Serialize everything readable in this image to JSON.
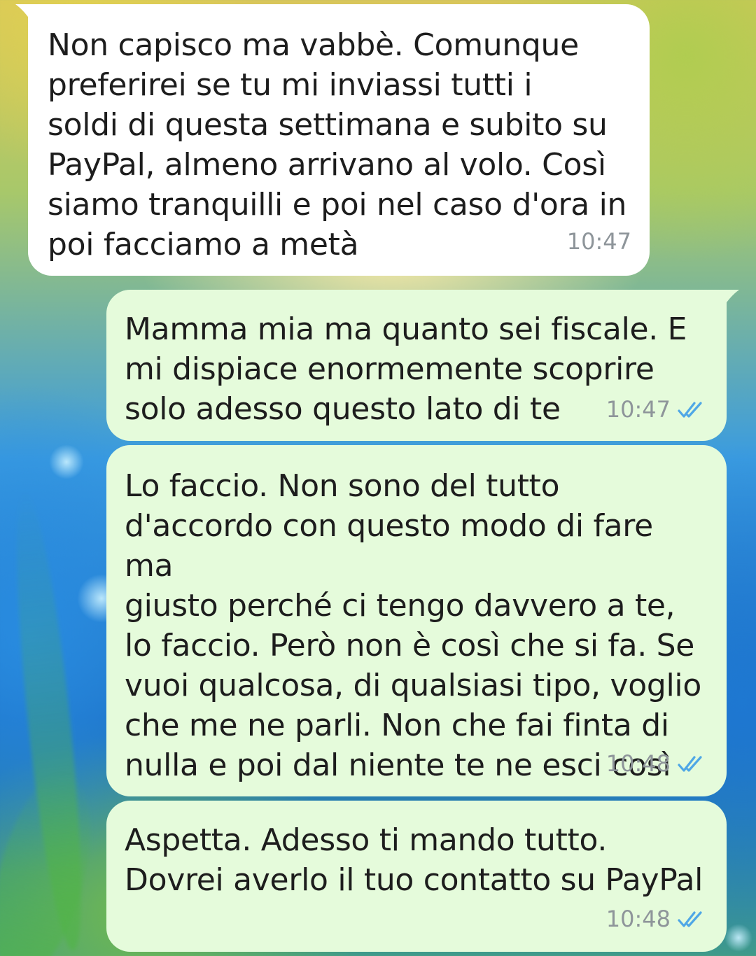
{
  "chat": {
    "messages": [
      {
        "direction": "incoming",
        "text": "Non capisco ma vabbè. Comunque\npreferirei se tu mi inviassi tutti i\nsoldi di questa settimana e subito su\nPayPal, almeno arrivano al volo. Così\nsiamo tranquilli e poi nel caso d'ora in\npoi facciamo a metà",
        "time": "10:47"
      },
      {
        "direction": "outgoing",
        "text": "Mamma mia ma quanto sei fiscale. E\nmi dispiace enormemente scoprire\nsolo adesso questo lato di te",
        "time": "10:47",
        "status": "read",
        "status_icon": "double-check-icon"
      },
      {
        "direction": "outgoing",
        "text": "Lo faccio. Non sono del tutto\nd'accordo con questo modo di fare ma\ngiusto perché ci tengo davvero a te,\nlo faccio. Però non è così che si fa. Se\nvuoi qualcosa, di qualsiasi tipo, voglio\nche me ne parli. Non che fai finta di\nnulla e poi dal niente te ne esci così",
        "time": "10:48",
        "status": "read",
        "status_icon": "double-check-icon"
      },
      {
        "direction": "outgoing",
        "text": "Aspetta. Adesso ti mando tutto.\nDovrei averlo il tuo contatto su PayPal",
        "time": "10:48",
        "status": "read",
        "status_icon": "double-check-icon"
      }
    ]
  },
  "colors": {
    "incoming_bubble": "#ffffff",
    "outgoing_bubble": "#e5fbdb",
    "read_ticks": "#4fa7e6",
    "timestamp": "#8e959a"
  }
}
